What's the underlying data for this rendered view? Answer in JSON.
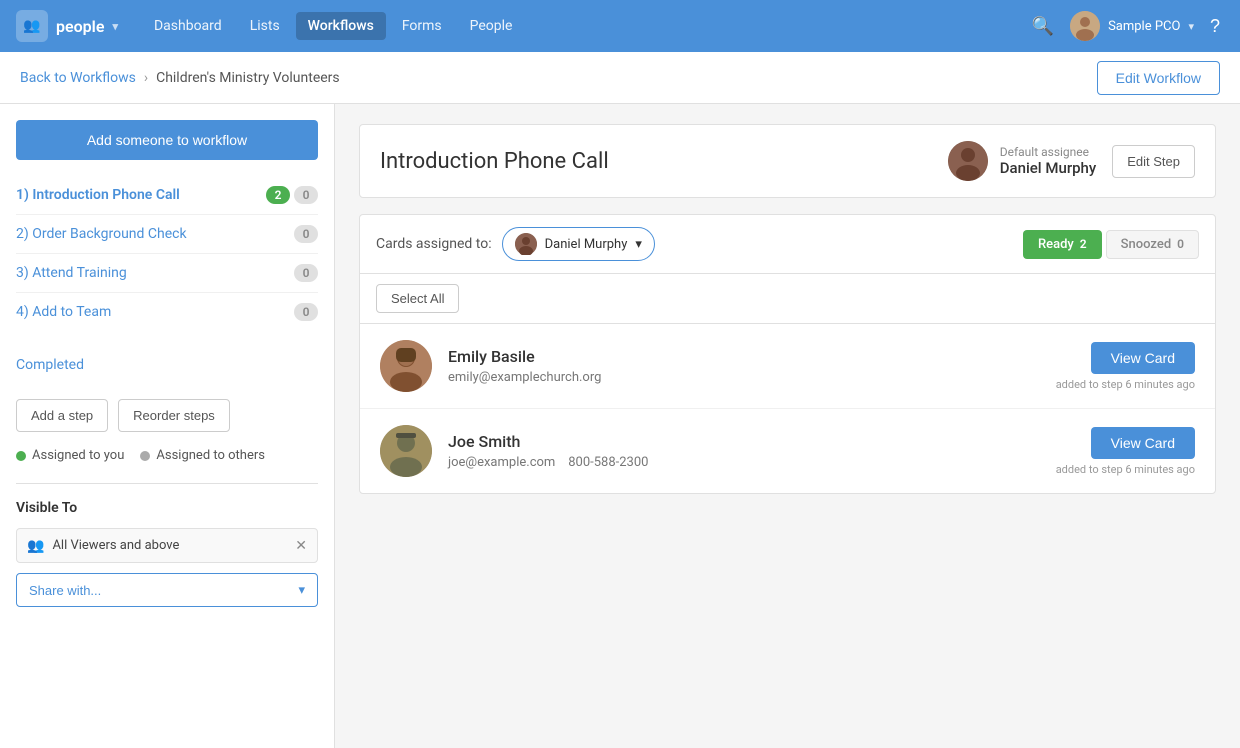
{
  "app": {
    "logo_text": "people",
    "logo_icon": "👥"
  },
  "nav": {
    "links": [
      {
        "id": "dashboard",
        "label": "Dashboard",
        "active": false
      },
      {
        "id": "lists",
        "label": "Lists",
        "active": false
      },
      {
        "id": "workflows",
        "label": "Workflows",
        "active": true
      },
      {
        "id": "forms",
        "label": "Forms",
        "active": false
      },
      {
        "id": "people",
        "label": "People",
        "active": false
      }
    ],
    "user_name": "Sample PCO",
    "help_icon": "?"
  },
  "breadcrumb": {
    "back_link": "Back to Workflows",
    "separator": "›",
    "current": "Children's Ministry Volunteers"
  },
  "edit_workflow_btn": "Edit Workflow",
  "sidebar": {
    "add_button": "Add someone to workflow",
    "steps": [
      {
        "id": 1,
        "label": "1) Introduction Phone Call",
        "active": true,
        "count_green": 2,
        "count_gray": 0
      },
      {
        "id": 2,
        "label": "2) Order Background Check",
        "active": false,
        "count_green": null,
        "count_gray": 0
      },
      {
        "id": 3,
        "label": "3) Attend Training",
        "active": false,
        "count_green": null,
        "count_gray": 0
      },
      {
        "id": 4,
        "label": "4) Add to Team",
        "active": false,
        "count_green": null,
        "count_gray": 0
      }
    ],
    "completed_label": "Completed",
    "add_step_btn": "Add a step",
    "reorder_btn": "Reorder steps",
    "legend": {
      "assigned_to_you": "Assigned to you",
      "assigned_to_others": "Assigned to others"
    },
    "visible_to": {
      "title": "Visible To",
      "item": "All Viewers and above",
      "share_placeholder": "Share with..."
    }
  },
  "main": {
    "step_title": "Introduction Phone Call",
    "default_assignee_label": "Default assignee",
    "default_assignee_name": "Daniel Murphy",
    "edit_step_btn": "Edit Step",
    "cards_filter": {
      "label": "Cards assigned to:",
      "assignee": "Daniel Murphy",
      "tabs": [
        {
          "id": "ready",
          "label": "Ready",
          "count": 2,
          "active": true
        },
        {
          "id": "snoozed",
          "label": "Snoozed",
          "count": 0,
          "active": false
        }
      ]
    },
    "select_all_btn": "Select All",
    "people": [
      {
        "id": "emily",
        "name": "Emily Basile",
        "email": "emily@examplechurch.org",
        "phone": "",
        "added_info": "added to step 6 minutes ago",
        "view_card_btn": "View Card"
      },
      {
        "id": "joe",
        "name": "Joe Smith",
        "email": "joe@example.com",
        "phone": "800-588-2300",
        "added_info": "added to step 6 minutes ago",
        "view_card_btn": "View Card"
      }
    ]
  }
}
